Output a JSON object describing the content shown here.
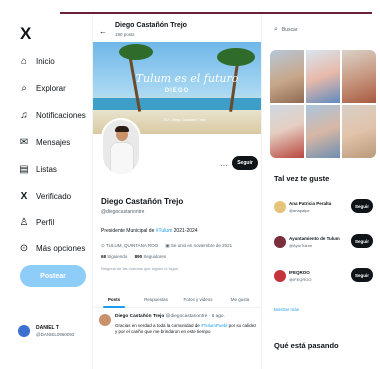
{
  "logo": "X",
  "nav": [
    {
      "icon": "⌂",
      "icon_name": "home-icon",
      "label": "Inicio"
    },
    {
      "icon": "⌕",
      "icon_name": "search-icon",
      "label": "Explorar"
    },
    {
      "icon": "♫",
      "icon_name": "bell-icon",
      "label": "Notificaciones"
    },
    {
      "icon": "✉",
      "icon_name": "mail-icon",
      "label": "Mensajes"
    },
    {
      "icon": "▤",
      "icon_name": "list-icon",
      "label": "Listas"
    },
    {
      "icon": "X",
      "icon_name": "verified-x-icon",
      "label": "Verificado"
    },
    {
      "icon": "♙",
      "icon_name": "profile-icon",
      "label": "Perfil"
    },
    {
      "icon": "⊙",
      "icon_name": "more-options-icon",
      "label": "Más opciones"
    }
  ],
  "post_button": "Postear",
  "account": {
    "name": "DANIEL T",
    "handle": "@DANIEL0960093"
  },
  "header": {
    "back_icon": "←",
    "title": "Diego Castañón Trejo",
    "subtitle": "180 posts"
  },
  "banner": {
    "title": "Tulum es el futuro",
    "subtitle": "DIEGO",
    "caption": "2021 Diego Castañón Trejo"
  },
  "profile": {
    "more_icon": "···",
    "follow_label": "Seguir",
    "name": "Diego Castañón Trejo",
    "handle": "@diegocastanontre",
    "bio_prefix": "Presidente Municipal de ",
    "bio_hashtag": "#Tulum",
    "bio_suffix": " 2021-2024",
    "location": "⊙ TULUM, QUINTANA ROO",
    "joined": "▣ Se unió en noviembre de 2021",
    "following_count": "68",
    "following_label": "Siguiendo",
    "followers_count": "890",
    "followers_label": "Seguidores",
    "not_followed": "Ninguna de las cuentas que sigues lo sigue"
  },
  "tabs": [
    "Posts",
    "Respuestas",
    "Fotos y videos",
    "Me gusta"
  ],
  "tweet": {
    "author": "Diego Castañón Trejo",
    "meta": " @diegocastanontre · 6 ago.",
    "body_prefix": "Gracias en verdad a toda la comunidad de ",
    "body_hashtag": "#TulumPuebl",
    "body_suffix": " por su calidez y por el cariño que me brindaron en este tiempo"
  },
  "search": {
    "icon": "⌕",
    "placeholder": "Buscar"
  },
  "suggestions_title": "Tal vez te guste",
  "suggestions": [
    {
      "name": "Ana Patricia Peralta",
      "handle": "@anapatpe",
      "button": "Seguir",
      "avatar_color": "#e7c27a"
    },
    {
      "name": "Ayuntamiento de Tulum",
      "handle": "@AytoTulum",
      "button": "Seguir",
      "avatar_color": "#7a2d3a"
    },
    {
      "name": "IFEQROO",
      "handle": "@IFEQROO",
      "button": "Seguir",
      "avatar_color": "#c4343c"
    }
  ],
  "show_more": "Mostrar más",
  "trending_title": "Qué está pasando"
}
